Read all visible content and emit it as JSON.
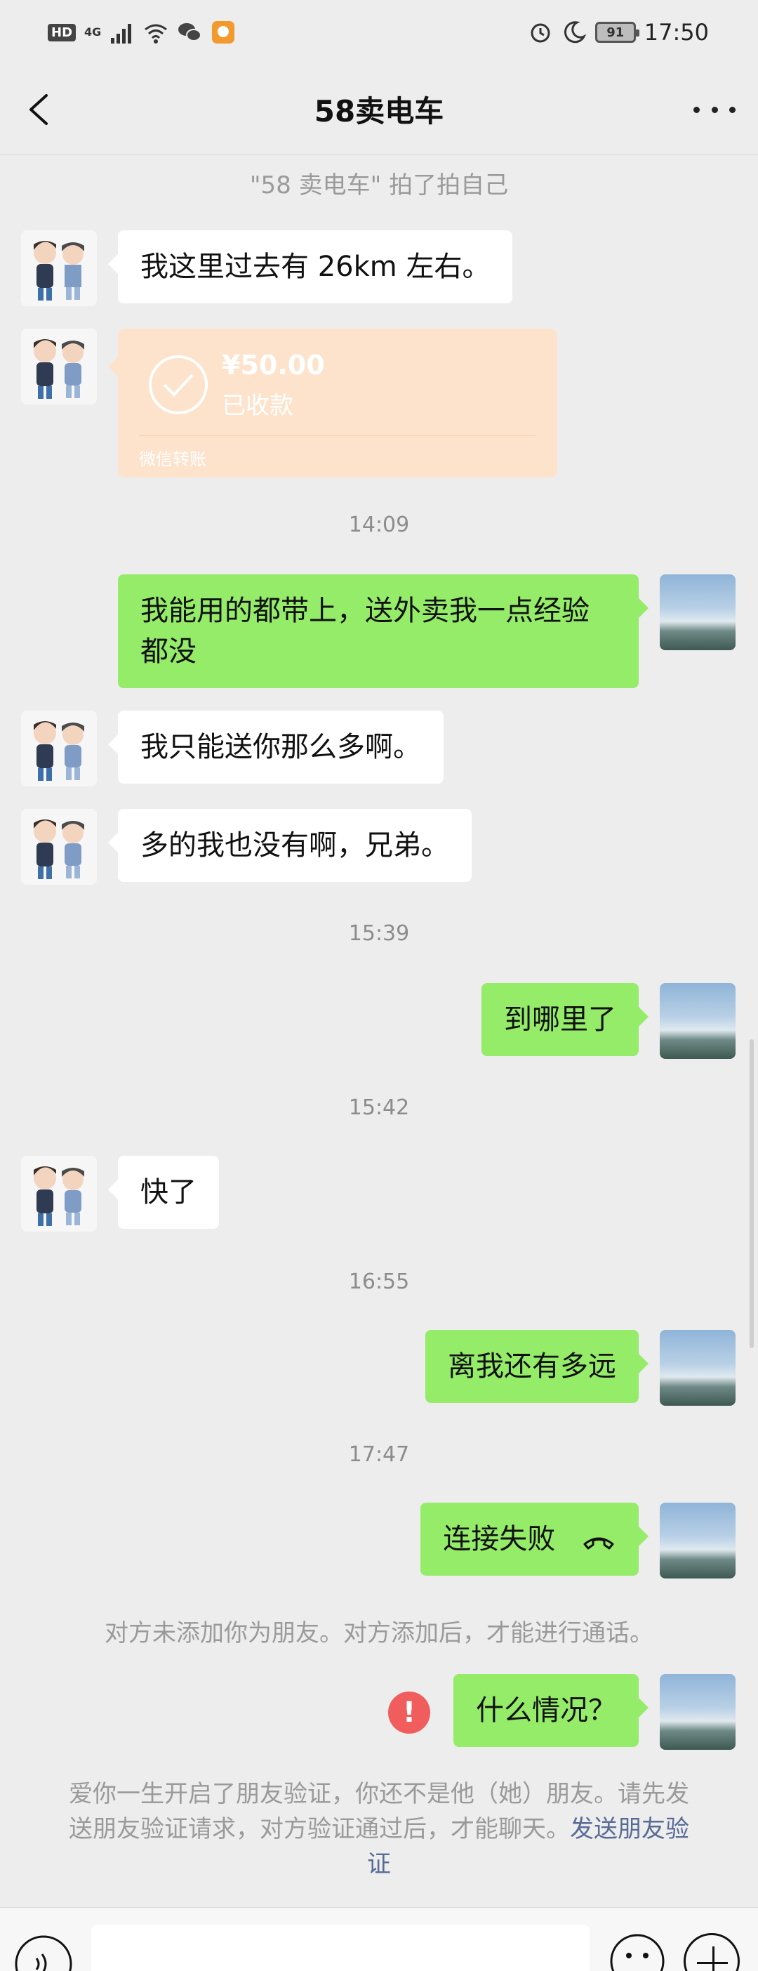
{
  "status_bar": {
    "hd": "HD",
    "network": "4G",
    "battery": "91",
    "time": "17:50"
  },
  "header": {
    "title": "58卖电车"
  },
  "messages": {
    "pat": "\"58 卖电车\" 拍了拍自己",
    "m1": "我这里过去有 26km 左右。",
    "transfer": {
      "amount": "¥50.00",
      "status": "已收款",
      "label": "微信转账"
    },
    "t1": "14:09",
    "m2": "我能用的都带上，送外卖我一点经验都没",
    "m3": "我只能送你那么多啊。",
    "m4": "多的我也没有啊，兄弟。",
    "t2": "15:39",
    "m5": "到哪里了",
    "t3": "15:42",
    "m6": "快了",
    "t4": "16:55",
    "m7": "离我还有多远",
    "t5": "17:47",
    "m8": "连接失败",
    "call_notice": "对方未添加你为朋友。对方添加后，才能进行通话。",
    "m9": "什么情况？",
    "error_symbol": "!",
    "verify_text": "爱你一生开启了朋友验证，你还不是他（她）朋友。请先发送朋友验证请求，对方验证通过后，才能聊天。",
    "verify_link": "发送朋友验证"
  },
  "colors": {
    "outgoing_bubble": "#95ec69",
    "incoming_bubble": "#ffffff",
    "background": "#ededed",
    "transfer_card": "#fde3cc",
    "error": "#f15c5c",
    "link": "#576b95"
  },
  "icons": {
    "back": "chevron-left-icon",
    "more": "more-dots-icon",
    "voice": "voice-icon",
    "emoji": "emoji-icon",
    "plus": "plus-icon",
    "hangup": "phone-hangup-icon"
  }
}
